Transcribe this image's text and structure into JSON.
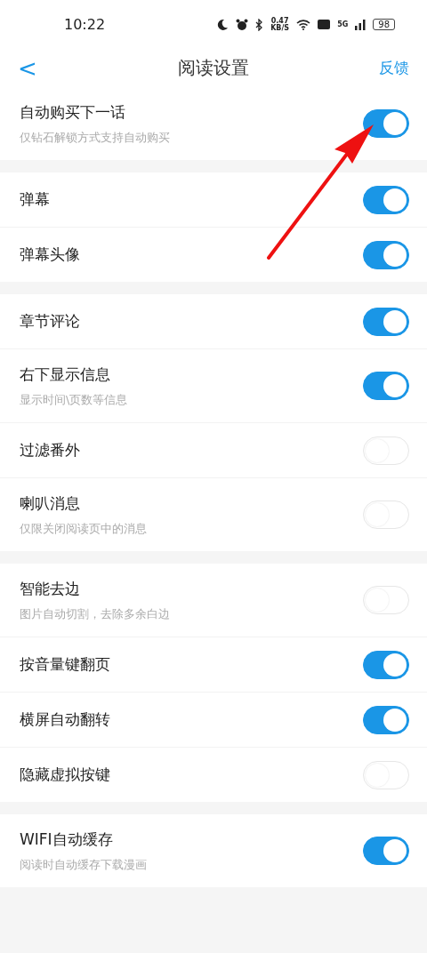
{
  "status_bar": {
    "time": "10:22",
    "net_speed": "0.47",
    "net_unit": "KB/S",
    "network": "5G",
    "battery": "98"
  },
  "header": {
    "back": "<",
    "title": "阅读设置",
    "action": "反馈"
  },
  "groups": [
    {
      "items": [
        {
          "label": "自动购买下一话",
          "description": "仅钻石解锁方式支持自动购买",
          "on": true
        }
      ]
    },
    {
      "items": [
        {
          "label": "弹幕",
          "on": true
        },
        {
          "label": "弹幕头像",
          "on": true
        }
      ]
    },
    {
      "items": [
        {
          "label": "章节评论",
          "on": true
        },
        {
          "label": "右下显示信息",
          "description": "显示时间\\页数等信息",
          "on": true
        },
        {
          "label": "过滤番外",
          "on": false
        },
        {
          "label": "喇叭消息",
          "description": "仅限关闭阅读页中的消息",
          "on": false
        }
      ]
    },
    {
      "items": [
        {
          "label": "智能去边",
          "description": "图片自动切割，去除多余白边",
          "on": false
        },
        {
          "label": "按音量键翻页",
          "on": true
        },
        {
          "label": "横屏自动翻转",
          "on": true
        },
        {
          "label": "隐藏虚拟按键",
          "on": false
        }
      ]
    },
    {
      "items": [
        {
          "label": "WIFI自动缓存",
          "description": "阅读时自动缓存下载漫画",
          "on": true
        }
      ]
    }
  ]
}
